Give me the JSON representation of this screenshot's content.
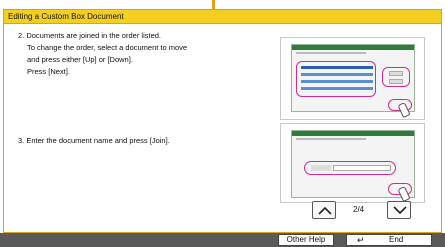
{
  "title": "Editing a Custom Box Document",
  "steps": {
    "step2": {
      "line1": "2. Documents are joined in the order listed.",
      "line2": "To change the order, select a document to move",
      "line3": "and press either [Up] or [Down].",
      "line4": "Press [Next]."
    },
    "step3": {
      "line1": "3. Enter the document name and press [Join]."
    }
  },
  "pagination": {
    "current": "2/4"
  },
  "buttons": {
    "other_help": "Other Help",
    "end": "End"
  },
  "icons": {
    "up": "chevron-up-icon",
    "down": "chevron-down-icon",
    "return": "return-arrow-icon"
  },
  "colors": {
    "accent_bar": "#f5cf1f",
    "highlight_ring": "#d42c8a",
    "bottom_bar": "#5a5a5a"
  }
}
